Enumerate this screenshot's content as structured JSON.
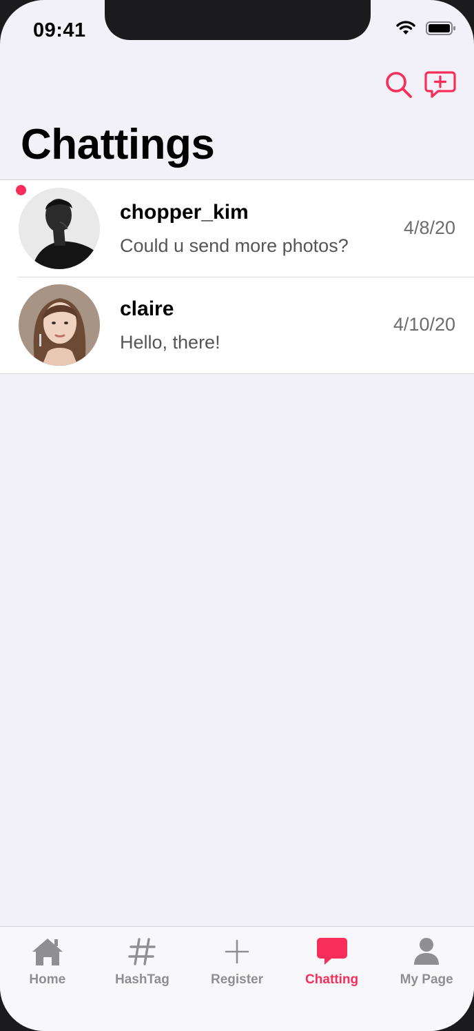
{
  "status_bar": {
    "time": "09:41"
  },
  "colors": {
    "accent": "#f72d5a",
    "inactive": "#8e8e93",
    "background": "#f2f1f7"
  },
  "header": {
    "title": "Chattings",
    "actions": [
      {
        "name": "search-icon"
      },
      {
        "name": "new-chat-icon"
      }
    ]
  },
  "chats": [
    {
      "name": "chopper_kim",
      "preview": "Could u send more photos?",
      "date": "4/8/20",
      "unread": true,
      "avatar": "avatar-chopper-kim"
    },
    {
      "name": "claire",
      "preview": "Hello, there!",
      "date": "4/10/20",
      "unread": false,
      "avatar": "avatar-claire"
    }
  ],
  "tabbar": {
    "tabs": [
      {
        "label": "Home",
        "icon": "home-icon",
        "active": false
      },
      {
        "label": "HashTag",
        "icon": "hashtag-icon",
        "active": false
      },
      {
        "label": "Register",
        "icon": "plus-icon",
        "active": false
      },
      {
        "label": "Chatting",
        "icon": "chat-bubble-icon",
        "active": true
      },
      {
        "label": "My Page",
        "icon": "person-icon",
        "active": false
      }
    ]
  }
}
